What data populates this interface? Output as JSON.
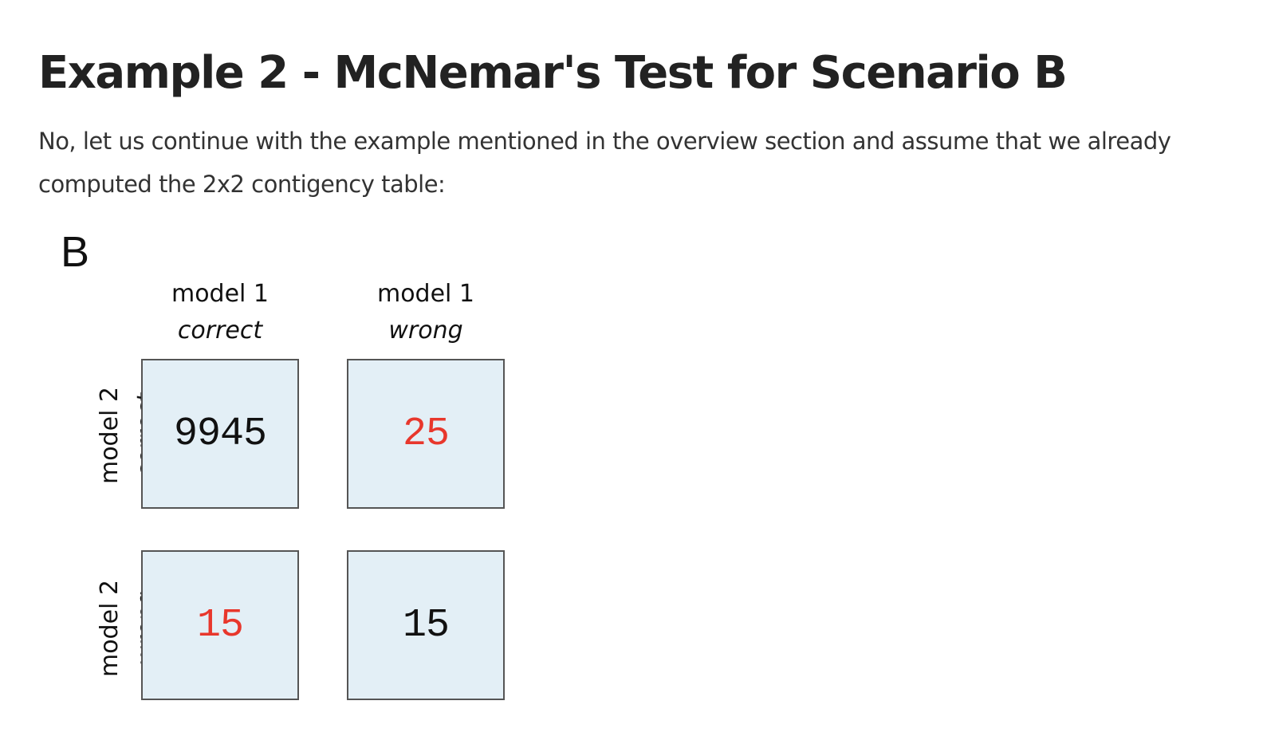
{
  "heading": "Example 2 - McNemar's Test for Scenario B",
  "paragraph": "No, let us continue with the example mentioned in the overview section and assume that we already computed the 2x2 contigency table:",
  "figure": {
    "panel_letter": "B",
    "columns": [
      {
        "line1": "model 1",
        "line2": "correct"
      },
      {
        "line1": "model 1",
        "line2": "wrong"
      }
    ],
    "rows": [
      {
        "line1": "model 2",
        "line2": "correct"
      },
      {
        "line1": "model 2",
        "line2": "wrong"
      }
    ],
    "cells": [
      {
        "value": "9945",
        "color": "#111111"
      },
      {
        "value": "25",
        "color": "#e8372c"
      },
      {
        "value": "15",
        "color": "#e8372c"
      },
      {
        "value": "15",
        "color": "#111111"
      }
    ],
    "cell_background": "#e3eff6",
    "highlight_color": "#e8372c"
  }
}
